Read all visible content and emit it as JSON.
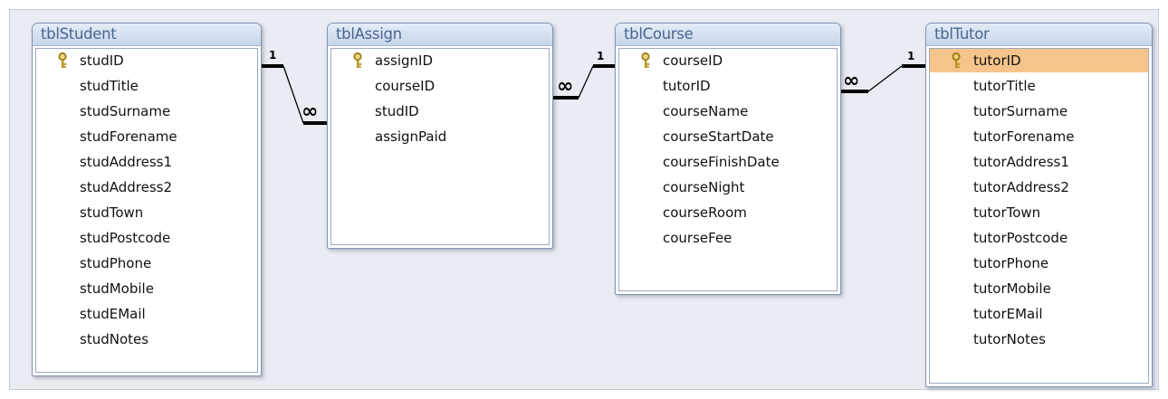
{
  "tables": [
    {
      "title": "tblStudent",
      "fields": [
        {
          "name": "studID",
          "primary_key": true
        },
        {
          "name": "studTitle"
        },
        {
          "name": "studSurname"
        },
        {
          "name": "studForename"
        },
        {
          "name": "studAddress1"
        },
        {
          "name": "studAddress2"
        },
        {
          "name": "studTown"
        },
        {
          "name": "studPostcode"
        },
        {
          "name": "studPhone"
        },
        {
          "name": "studMobile"
        },
        {
          "name": "studEMail"
        },
        {
          "name": "studNotes"
        }
      ]
    },
    {
      "title": "tblAssign",
      "fields": [
        {
          "name": "assignID",
          "primary_key": true
        },
        {
          "name": "courseID"
        },
        {
          "name": "studID"
        },
        {
          "name": "assignPaid"
        }
      ]
    },
    {
      "title": "tblCourse",
      "fields": [
        {
          "name": "courseID",
          "primary_key": true
        },
        {
          "name": "tutorID"
        },
        {
          "name": "courseName"
        },
        {
          "name": "courseStartDate"
        },
        {
          "name": "courseFinishDate"
        },
        {
          "name": "courseNight"
        },
        {
          "name": "courseRoom"
        },
        {
          "name": "courseFee"
        }
      ]
    },
    {
      "title": "tblTutor",
      "fields": [
        {
          "name": "tutorID",
          "primary_key": true,
          "selected": true
        },
        {
          "name": "tutorTitle"
        },
        {
          "name": "tutorSurname"
        },
        {
          "name": "tutorForename"
        },
        {
          "name": "tutorAddress1"
        },
        {
          "name": "tutorAddress2"
        },
        {
          "name": "tutorTown"
        },
        {
          "name": "tutorPostcode"
        },
        {
          "name": "tutorPhone"
        },
        {
          "name": "tutorMobile"
        },
        {
          "name": "tutorEMail"
        },
        {
          "name": "tutorNotes"
        }
      ]
    }
  ],
  "relationships": [
    {
      "one_table": "tblStudent",
      "one_field": "studID",
      "many_table": "tblAssign",
      "many_field": "studID",
      "one_label": "1",
      "many_label": "∞"
    },
    {
      "one_table": "tblCourse",
      "one_field": "courseID",
      "many_table": "tblAssign",
      "many_field": "courseID",
      "one_label": "1",
      "many_label": "∞"
    },
    {
      "one_table": "tblTutor",
      "one_field": "tutorID",
      "many_table": "tblCourse",
      "many_field": "tutorID",
      "one_label": "1",
      "many_label": "∞"
    }
  ],
  "colors": {
    "canvas": "#e9ecf2",
    "title_text": "#4a6590",
    "selected_row": "#f6c48b",
    "key_icon": "#c9a227",
    "join_line": "#000000"
  },
  "icons": {
    "primary_key": "key-icon"
  }
}
